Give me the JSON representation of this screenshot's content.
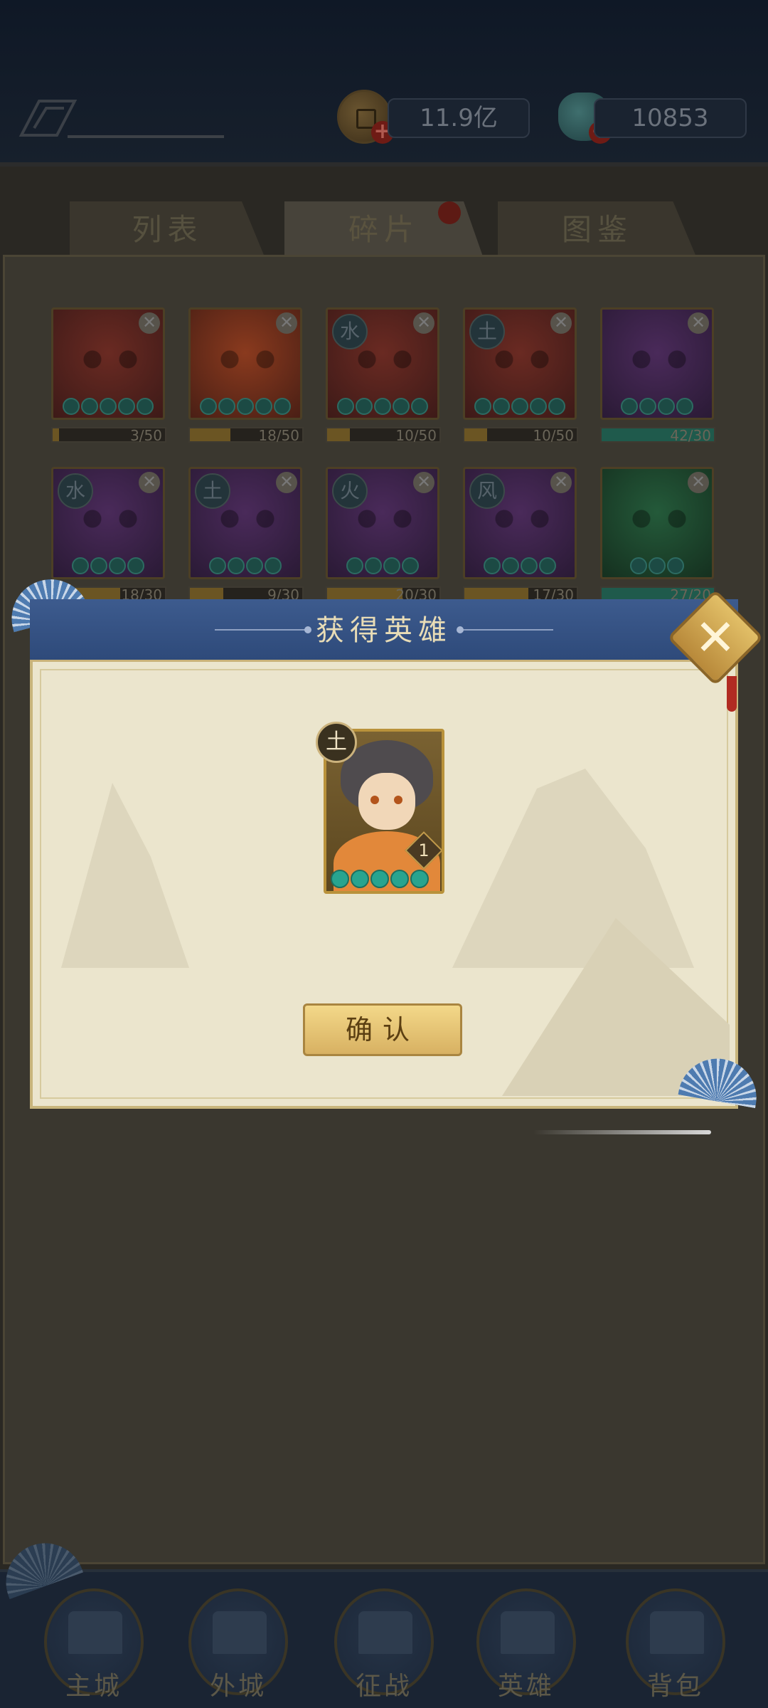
{
  "topbar": {
    "coin_amount": "11.9亿",
    "gem_amount": "10853",
    "plus_symbol": "+"
  },
  "tabs": [
    {
      "label": "列表",
      "active": false
    },
    {
      "label": "碎片",
      "active": true,
      "has_red_dot": true
    },
    {
      "label": "图鉴",
      "active": false
    }
  ],
  "fragment_cards": [
    {
      "progress": "3/50",
      "fraction": 0.06,
      "element": "",
      "tone": "red",
      "stars": 5
    },
    {
      "progress": "18/50",
      "fraction": 0.36,
      "element": "",
      "tone": "red-bright",
      "stars": 5
    },
    {
      "progress": "10/50",
      "fraction": 0.2,
      "element": "水",
      "tone": "red",
      "stars": 5
    },
    {
      "progress": "10/50",
      "fraction": 0.2,
      "element": "土",
      "tone": "red",
      "stars": 5
    },
    {
      "progress": "42/30",
      "fraction": 1.0,
      "element": "",
      "tone": "purple",
      "stars": 4
    },
    {
      "progress": "18/30",
      "fraction": 0.6,
      "element": "水",
      "tone": "purple",
      "stars": 4
    },
    {
      "progress": "9/30",
      "fraction": 0.3,
      "element": "土",
      "tone": "purple",
      "stars": 4
    },
    {
      "progress": "20/30",
      "fraction": 0.67,
      "element": "火",
      "tone": "purple",
      "stars": 4
    },
    {
      "progress": "17/30",
      "fraction": 0.57,
      "element": "风",
      "tone": "purple",
      "stars": 4
    },
    {
      "progress": "27/20",
      "fraction": 1.0,
      "element": "",
      "tone": "green",
      "stars": 3
    }
  ],
  "modal": {
    "title": "获得英雄",
    "confirm_label": "确认",
    "close_symbol": "✕",
    "hero": {
      "element": "土",
      "level": "1",
      "stars": 5
    }
  },
  "bottom_nav": [
    {
      "label": "主城",
      "icon": "main-city-icon"
    },
    {
      "label": "外城",
      "icon": "outer-city-icon"
    },
    {
      "label": "征战",
      "icon": "campaign-icon"
    },
    {
      "label": "英雄",
      "icon": "hero-icon"
    },
    {
      "label": "背包",
      "icon": "bag-icon"
    }
  ],
  "colors": {
    "header_blue": "#3d5b8e",
    "parchment": "#ebe5cd",
    "gold": "#d8b162"
  }
}
